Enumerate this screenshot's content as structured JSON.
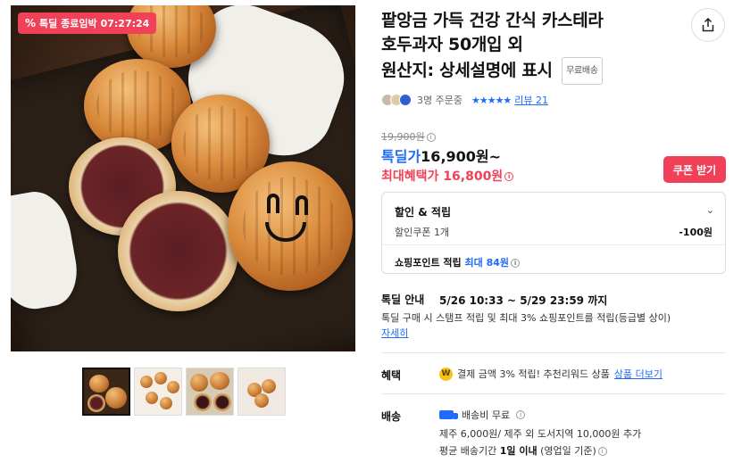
{
  "badge": {
    "icon": "percent-icon",
    "label": "톡딜 종료임박",
    "timer": "07:27:24"
  },
  "product": {
    "title_lines": [
      "팥앙금 가득 건강 간식 카스테라",
      "호두과자 50개입 외",
      "원산지: 상세설명에 표시"
    ],
    "free_ship_tag": "무료배송"
  },
  "meta": {
    "orders": "3명 주문중",
    "stars": "★★★★★",
    "review": "리뷰 21"
  },
  "price": {
    "original": "19,900원",
    "deal_label": "톡딜가",
    "deal_price": "16,900원~",
    "max_label": "최대혜택가",
    "max_price": "16,800원",
    "coupon_button": "쿠폰 받기"
  },
  "discount_box": {
    "header": "할인 & 적립",
    "coupon_label": "할인쿠폰 1개",
    "coupon_value": "-100원",
    "point_label": "쇼핑포인트 적립",
    "point_value": "최대 84원"
  },
  "deal": {
    "label": "톡딜 안내",
    "period": "5/26 10:33 ~ 5/29 23:59 까지",
    "desc": "톡딜 구매 시 스탬프 적립 및 최대 3% 쇼핑포인트를 적립(등급별 상이)",
    "more": "자세히"
  },
  "benefit": {
    "label": "혜택",
    "coin": "W",
    "text": "결제 금액 3% 적립! 추천리워드 상품",
    "link": "상품 더보기"
  },
  "shipping": {
    "label": "배송",
    "fee": "배송비 무료",
    "extra": "제주 6,000원/ 제주 외 도서지역 10,000원 추가",
    "avg_prefix": "평균 배송기간",
    "avg_days": "1일 이내",
    "avg_suffix": "(영업일 기준)"
  },
  "thumbnails": [
    "thumbnail-1",
    "thumbnail-2",
    "thumbnail-3",
    "thumbnail-4"
  ]
}
